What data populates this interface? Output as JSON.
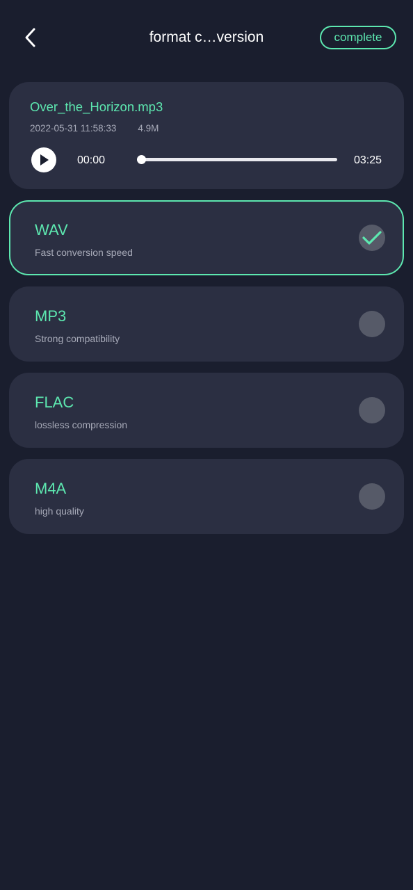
{
  "header": {
    "title": "format c…version",
    "complete_label": "complete"
  },
  "file": {
    "name": "Over_the_Horizon.mp3",
    "date": "2022-05-31 11:58:33",
    "size": "4.9M",
    "current_time": "00:00",
    "total_time": "03:25",
    "progress_fraction": 0
  },
  "formats": [
    {
      "name": "WAV",
      "desc": "Fast conversion speed",
      "selected": true
    },
    {
      "name": "MP3",
      "desc": "Strong compatibility",
      "selected": false
    },
    {
      "name": "FLAC",
      "desc": "lossless compression",
      "selected": false
    },
    {
      "name": "M4A",
      "desc": "high quality",
      "selected": false
    }
  ],
  "colors": {
    "background": "#1a1e2e",
    "card": "#2b2f42",
    "accent": "#5de8b0",
    "muted_text": "#a7aab8",
    "radio_off": "#565a68"
  },
  "icons": {
    "back": "chevron-left-icon",
    "play": "play-icon",
    "check": "checkmark-icon"
  }
}
